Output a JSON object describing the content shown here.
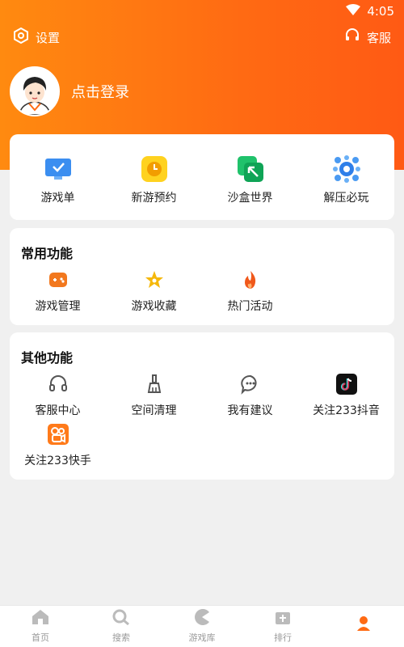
{
  "status_bar": {
    "time": "4:05"
  },
  "header": {
    "settings_label": "设置",
    "service_label": "客服",
    "login_label": "点击登录"
  },
  "featured": {
    "items": [
      {
        "label": "游戏单",
        "icon": "game-list-icon"
      },
      {
        "label": "新游预约",
        "icon": "clock-icon"
      },
      {
        "label": "沙盒世界",
        "icon": "sandbox-icon"
      },
      {
        "label": "解压必玩",
        "icon": "decompress-icon"
      }
    ]
  },
  "common": {
    "title": "常用功能",
    "items": [
      {
        "label": "游戏管理",
        "icon": "gamepad-icon"
      },
      {
        "label": "游戏收藏",
        "icon": "star-icon"
      },
      {
        "label": "热门活动",
        "icon": "fire-icon"
      }
    ]
  },
  "other": {
    "title": "其他功能",
    "items": [
      {
        "label": "客服中心",
        "icon": "headset-icon"
      },
      {
        "label": "空间清理",
        "icon": "broom-icon"
      },
      {
        "label": "我有建议",
        "icon": "chat-icon"
      },
      {
        "label": "关注233抖音",
        "icon": "douyin-icon"
      },
      {
        "label": "关注233快手",
        "icon": "kuaishou-icon"
      }
    ]
  },
  "bottom_nav": {
    "items": [
      {
        "label": "首页",
        "icon": "home-icon"
      },
      {
        "label": "搜索",
        "icon": "search-icon"
      },
      {
        "label": "游戏库",
        "icon": "game-library-icon"
      },
      {
        "label": "排行",
        "icon": "ranking-icon"
      },
      {
        "label": "",
        "icon": "profile-icon",
        "active": true
      }
    ]
  },
  "colors": {
    "header_gradient_start": "#ff8a10",
    "header_gradient_end": "#ff5a14",
    "accent": "#ff6a13",
    "background": "#f0f0f0"
  }
}
